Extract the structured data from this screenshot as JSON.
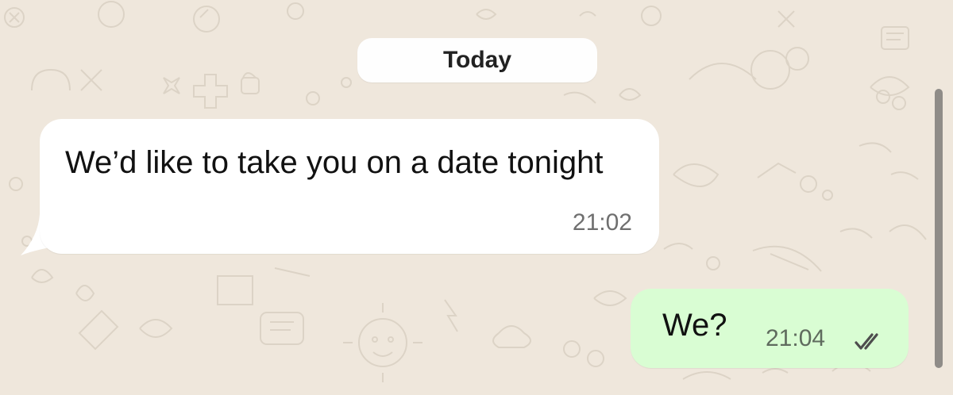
{
  "chat": {
    "date_chip": "Today",
    "incoming": {
      "text": "We’d like to take you on a date tonight",
      "time": "21:02"
    },
    "outgoing": {
      "text": "We?",
      "time": "21:04",
      "status_icon": "double-check-icon"
    }
  },
  "colors": {
    "background": "#efe7dc",
    "incoming_bubble": "#ffffff",
    "outgoing_bubble": "#d9fdd3",
    "read_ticks": "#4d4d4d"
  }
}
